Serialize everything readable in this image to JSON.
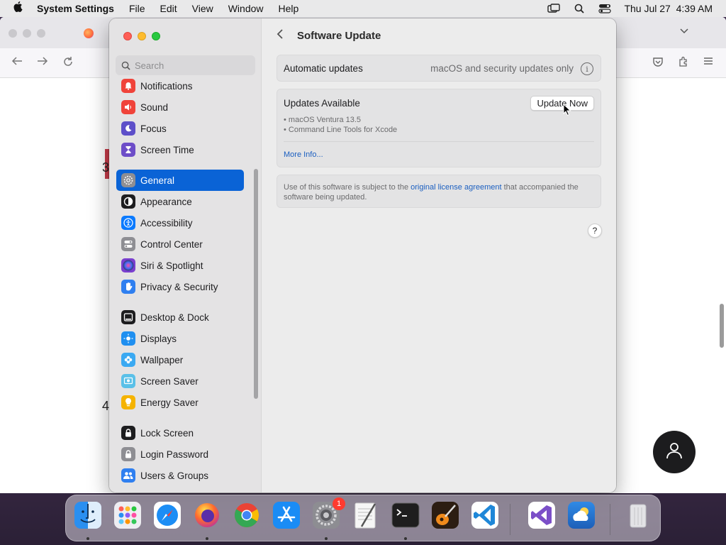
{
  "menubar": {
    "app_name": "System Settings",
    "menus": [
      "File",
      "Edit",
      "View",
      "Window",
      "Help"
    ],
    "datetime": "Thu Jul 27  4:39 AM"
  },
  "browser": {
    "fragment_3": "3",
    "fragment_4": "4"
  },
  "settings": {
    "search_placeholder": "Search",
    "sidebar": [
      {
        "label": "Notifications",
        "icon": "bell-icon",
        "color": "#f0433a"
      },
      {
        "label": "Sound",
        "icon": "speaker-icon",
        "color": "#f0433a"
      },
      {
        "label": "Focus",
        "icon": "moon-icon",
        "color": "#5d4fc9"
      },
      {
        "label": "Screen Time",
        "icon": "hourglass-icon",
        "color": "#6d4dc8"
      },
      {
        "label": "General",
        "icon": "gear-icon",
        "color": "#8e8e93",
        "selected": true
      },
      {
        "label": "Appearance",
        "icon": "appearance-icon",
        "color": "#1d1d1f"
      },
      {
        "label": "Accessibility",
        "icon": "accessibility-icon",
        "color": "#0a7aff"
      },
      {
        "label": "Control Center",
        "icon": "control-center-icon",
        "color": "#8e8e93"
      },
      {
        "label": "Siri & Spotlight",
        "icon": "siri-icon",
        "color": "#7a3fcf"
      },
      {
        "label": "Privacy & Security",
        "icon": "hand-icon",
        "color": "#2f7ff0"
      },
      {
        "label": "Desktop & Dock",
        "icon": "dock-icon",
        "color": "#1d1d1f"
      },
      {
        "label": "Displays",
        "icon": "sun-icon",
        "color": "#1f8ff0"
      },
      {
        "label": "Wallpaper",
        "icon": "flower-icon",
        "color": "#3aa9f2"
      },
      {
        "label": "Screen Saver",
        "icon": "screen-saver-icon",
        "color": "#5ac0e8"
      },
      {
        "label": "Energy Saver",
        "icon": "lightbulb-icon",
        "color": "#f5b300"
      },
      {
        "label": "Lock Screen",
        "icon": "lock-icon",
        "color": "#1d1d1f"
      },
      {
        "label": "Login Password",
        "icon": "lock-password-icon",
        "color": "#8e8e93"
      },
      {
        "label": "Users & Groups",
        "icon": "users-icon",
        "color": "#2f7ff0"
      }
    ],
    "page_title": "Software Update",
    "auto_updates": {
      "label": "Automatic updates",
      "value": "macOS and security updates only"
    },
    "updates": {
      "label": "Updates Available",
      "button": "Update Now",
      "items": [
        "• macOS Ventura 13.5",
        "• Command Line Tools for Xcode"
      ],
      "more": "More Info..."
    },
    "license": {
      "text_before": "Use of this software is subject to the ",
      "link": "original license agreement",
      "text_after": " that accompanied the software being updated."
    },
    "help": "?"
  },
  "dock": {
    "apps": [
      {
        "name": "Finder",
        "icon": "finder-icon",
        "color": "#2a8ff0"
      },
      {
        "name": "Launchpad",
        "icon": "launchpad-icon",
        "color": "#e9e9ee"
      },
      {
        "name": "Safari",
        "icon": "safari-icon",
        "color": "#1c8df5"
      },
      {
        "name": "Firefox",
        "icon": "firefox-icon",
        "color": "#ff7139"
      },
      {
        "name": "Chrome",
        "icon": "chrome-icon",
        "color": "#ffffff"
      },
      {
        "name": "App Store",
        "icon": "app-store-icon",
        "color": "#1a8cf5"
      },
      {
        "name": "System Settings",
        "icon": "settings-gear-icon",
        "color": "#8d8d92",
        "badge": "1"
      },
      {
        "name": "TextEdit",
        "icon": "textedit-icon",
        "color": "#f4f4f4"
      },
      {
        "name": "Terminal",
        "icon": "terminal-icon",
        "color": "#1e1e1e"
      },
      {
        "name": "GarageBand",
        "icon": "guitar-icon",
        "color": "#f08a1c"
      },
      {
        "name": "Visual Studio Code",
        "icon": "vscode-icon",
        "color": "#ffffff"
      },
      {
        "name": "Visual Studio",
        "icon": "visual-studio-icon",
        "color": "#ffffff"
      },
      {
        "name": "Weather",
        "icon": "weather-icon",
        "color": "#2a7ad8"
      },
      {
        "name": "Trash",
        "icon": "trash-icon",
        "color": "#e8e8ea"
      }
    ]
  }
}
